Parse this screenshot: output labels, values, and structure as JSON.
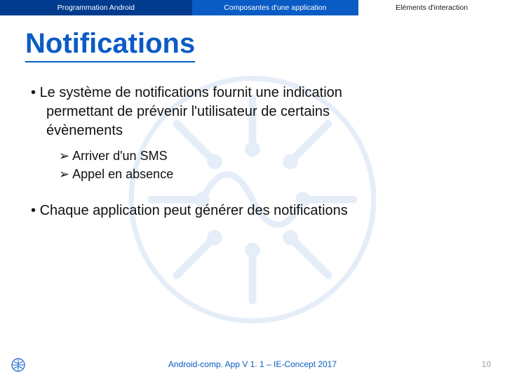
{
  "header": {
    "tab1": "Programmation Android",
    "tab2": "Composantes d'une application",
    "tab3": "Eléments d'interaction"
  },
  "title": "Notifications",
  "bullets": {
    "b1_line1": "Le système de notifications fournit une indication",
    "b1_line2": "permettant de prévenir l'utilisateur de certains",
    "b1_line3": "évènements",
    "b1_sub1": "Arriver d'un SMS",
    "b1_sub2": "Appel en absence",
    "b2": "Chaque application peut générer des  notifications"
  },
  "footer": "Android-comp. App V 1. 1 – IE-Concept 2017",
  "page": "10",
  "colors": {
    "accent": "#0a5cc4",
    "dark": "#003b8e"
  }
}
